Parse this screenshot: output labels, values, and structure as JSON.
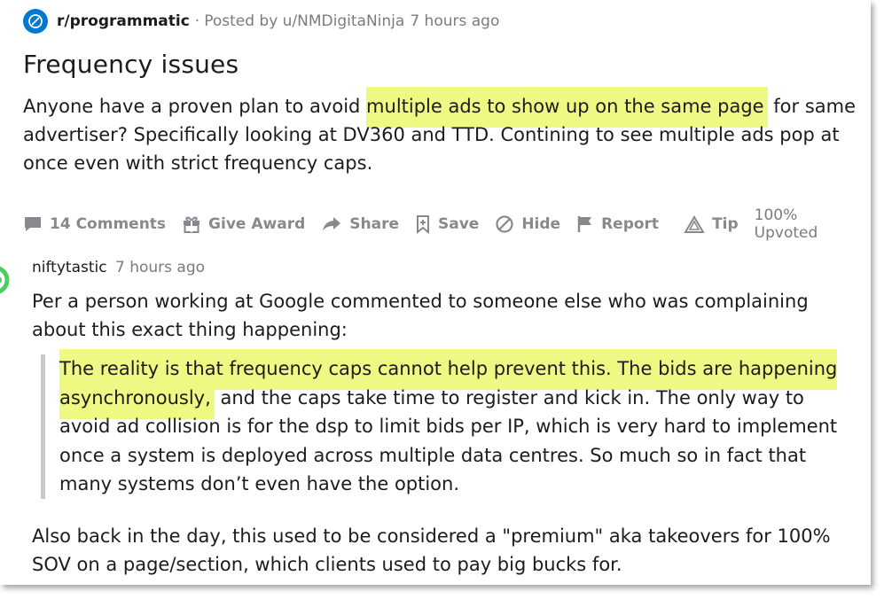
{
  "post": {
    "subreddit": "r/programmatic",
    "separator": "·",
    "posted_by": "Posted by u/NMDigitaNinja",
    "time": "7 hours ago",
    "title": "Frequency issues",
    "body_pre": "Anyone have a proven plan to avoid ",
    "body_highlight": "multiple ads to show up on the same page",
    "body_post": " for same advertiser? Specifically looking at DV360 and TTD. Contining to see multiple ads pop at once even with strict frequency caps."
  },
  "actions": {
    "comments": "14 Comments",
    "award": "Give Award",
    "share": "Share",
    "save": "Save",
    "hide": "Hide",
    "report": "Report",
    "tip": "Tip",
    "upvoted": "100% Upvoted"
  },
  "comment": {
    "author": "niftytastic",
    "time": "7 hours ago",
    "intro": "Per a person working at Google commented to someone else who was complaining about this exact thing happening:",
    "quote_highlight": "The reality is that frequency caps cannot help prevent this. The bids are happening asynchronously,",
    "quote_rest": " and the caps take time to register and kick in. The only way to avoid ad collision is for the dsp to limit bids per IP, which is very hard to implement once a system is deployed across multiple data centres. So much so in fact that many systems don’t even have the option.",
    "followup": "Also back in the day, this used to be considered a \"premium\" aka takeovers for 100% SOV on a page/section, which clients used to pay big bucks for."
  },
  "colors": {
    "highlight": "#eef882",
    "subreddit_icon": "#0079d3",
    "action_gray": "#878a8c",
    "avatar_green": "#46d160"
  },
  "icons": {
    "subreddit": "reddit-community-icon",
    "comments": "comment-bubble-icon",
    "award": "gift-icon",
    "share": "share-arrow-icon",
    "save": "bookmark-icon",
    "hide": "hide-icon",
    "report": "flag-icon",
    "tip": "tip-triangle-icon"
  }
}
